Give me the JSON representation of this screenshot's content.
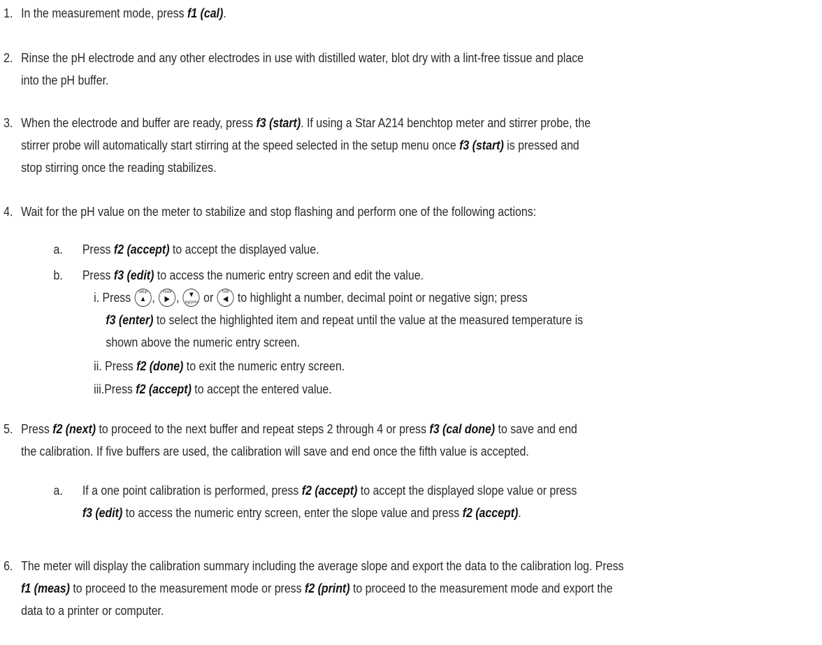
{
  "steps": [
    {
      "num": "1.",
      "t1": "In the measurement mode, press ",
      "k1": "f1 (cal)",
      "t2": "."
    },
    {
      "num": "2.",
      "line1": "Rinse the pH electrode and any other electrodes in use with distilled water, blot dry with a lint-free tissue and place",
      "line2": "into the pH buffer."
    },
    {
      "num": "3.",
      "t1": "When the electrode and buffer are ready, press ",
      "k1": "f3 (start)",
      "t2": ". If using a Star A214 benchtop meter and stirrer probe, the",
      "t3": "stirrer probe will automatically start stirring at the speed selected in the setup menu once ",
      "k2": "f3 (start)",
      "t4": " is pressed and",
      "t5": "stop stirring once the reading stabilizes."
    },
    {
      "num": "4.",
      "text": "Wait for the pH value on the meter to stabilize and stop flashing and perform one of the following actions:",
      "a": {
        "label": "a.",
        "t1": "Press ",
        "k1": "f2 (accept)",
        "t2": " to accept the displayed value."
      },
      "b": {
        "label": "b.",
        "t1": "Press ",
        "k1": "f3 (edit)",
        "t2": " to access the numeric entry screen and edit the value."
      },
      "i": {
        "label": "i.",
        "t1": "Press ",
        "sep1": ", ",
        "sep2": ", ",
        "sep3": " or ",
        "t2": " to highlight a number, decimal point or negative sign; press",
        "k1": "f3 (enter)",
        "t3": " to select the highlighted item and repeat until the value at the measured temperature is",
        "t4": "shown above the numeric entry screen."
      },
      "ii": {
        "label": "ii.",
        "t1": "Press ",
        "k1": "f2 (done)",
        "t2": " to exit the numeric entry screen."
      },
      "iii": {
        "label": "iii.",
        "t1": "Press ",
        "k1": "f2 (accept)",
        "t2": " to accept the entered value."
      }
    },
    {
      "num": "5.",
      "t1": "Press ",
      "k1": "f2 (next)",
      "t2": " to proceed to the next buffer and repeat steps 2 through 4 or press ",
      "k2": "f3 (cal done)",
      "t3": " to save and end",
      "t4": "the calibration. If five buffers are used, the calibration will save and end once the fifth value is accepted.",
      "a": {
        "label": "a.",
        "t1": "If a one point calibration is performed, press ",
        "k1": "f2 (accept)",
        "t2": " to accept the displayed slope value or press",
        "k2": "f3 (edit)",
        "t3": " to access the numeric entry screen, enter the slope value and press ",
        "k3": "f2 (accept)",
        "t4": "."
      }
    },
    {
      "num": "6.",
      "t1": "The meter will display the calibration summary including the average slope and export the data to the calibration log. Press",
      "k1": "f1 (meas)",
      "t2": " to proceed to the measurement mode or press ",
      "k2": "f2 (print)",
      "t3": " to proceed to the measurement mode and export the",
      "t4": "data to a printer or computer."
    }
  ],
  "keys": {
    "setup": {
      "label": "setup",
      "icon": "up-arrow-icon",
      "glyph": "▲"
    },
    "mode": {
      "label": "mode",
      "icon": "right-arrow-icon",
      "glyph": "▶"
    },
    "logprint": {
      "label": "log/print",
      "icon": "down-arrow-icon",
      "glyph": "▼"
    },
    "hold": {
      "label": "hold",
      "icon": "left-arrow-icon",
      "glyph": "◀"
    }
  }
}
